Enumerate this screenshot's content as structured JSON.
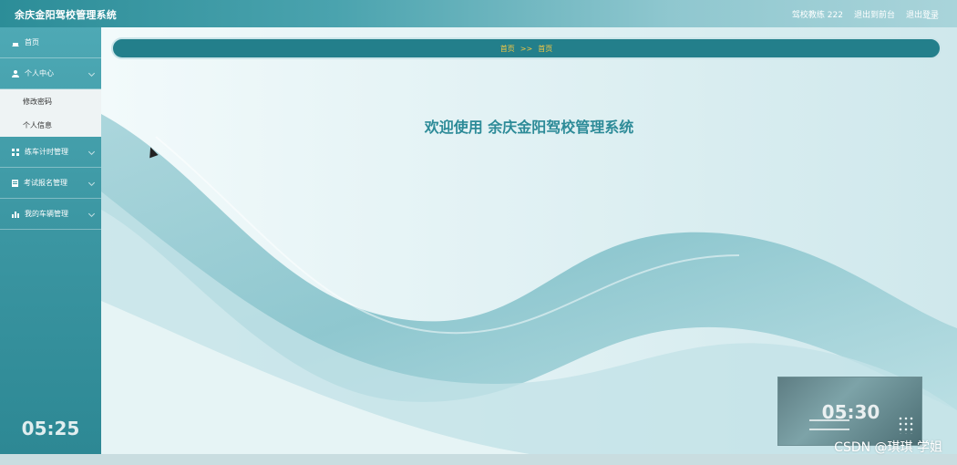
{
  "header": {
    "title": "余庆金阳驾校管理系统",
    "user_label": "驾校教练 222",
    "back_to_front": "退出到前台",
    "logout": "退出登录"
  },
  "sidebar": {
    "items": [
      {
        "label": "首页",
        "icon": "home-icon"
      },
      {
        "label": "个人中心",
        "icon": "user-icon",
        "expanded": true,
        "children": [
          {
            "label": "修改密码"
          },
          {
            "label": "个人信息"
          }
        ]
      },
      {
        "label": "练车计时管理",
        "icon": "grid-icon"
      },
      {
        "label": "考试报名管理",
        "icon": "document-icon"
      },
      {
        "label": "我的车辆管理",
        "icon": "bar-chart-icon"
      }
    ],
    "clock": "05:25"
  },
  "breadcrumb": {
    "home": "首页",
    "separator": ">>",
    "current": "首页"
  },
  "main": {
    "welcome": "欢迎使用 余庆金阳驾校管理系统"
  },
  "overlay": {
    "video_time": "05:30",
    "watermark": "CSDN @琪琪 学姐"
  },
  "colors": {
    "accent": "#237f8b",
    "breadcrumb_text": "#f5c843",
    "welcome_text": "#2d8b98"
  }
}
